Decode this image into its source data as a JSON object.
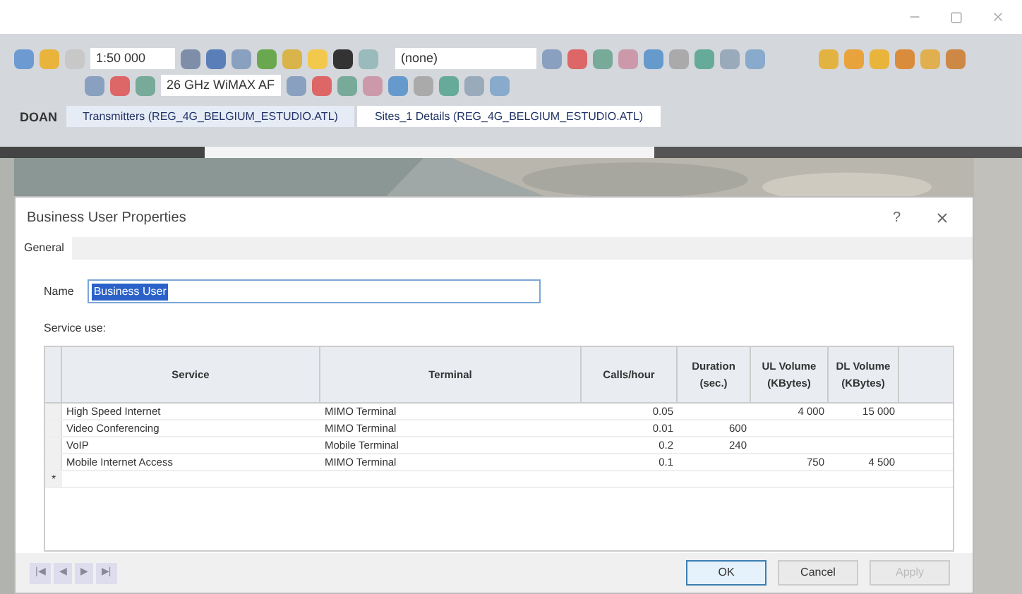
{
  "toolbar": {
    "scale": "1:50 000",
    "frequency_band": "26 GHz WiMAX AF",
    "filter": "(none)"
  },
  "document_tabs": [
    {
      "label": "DOAN",
      "kind": "app",
      "selected": false
    },
    {
      "label": "Transmitters (REG_4G_BELGIUM_ESTUDIO.ATL)",
      "kind": "tab",
      "selected": false
    },
    {
      "label": "Sites_1 Details (REG_4G_BELGIUM_ESTUDIO.ATL)",
      "kind": "tab",
      "selected": true
    }
  ],
  "dialog": {
    "title": "Business User Properties",
    "help": "?",
    "tabs": [
      {
        "label": "General",
        "selected": true
      }
    ],
    "name_label": "Name",
    "name_value": "Business User",
    "name_selected": true,
    "service_use_label": "Service use:",
    "table": {
      "columns": [
        "Service",
        "Terminal",
        "Calls/hour",
        "Duration (sec.)",
        "UL Volume (KBytes)",
        "DL Volume (KBytes)"
      ],
      "rows": [
        [
          "High Speed Internet",
          "MIMO Terminal",
          "0.05",
          "",
          "4 000",
          "15 000"
        ],
        [
          "Video Conferencing",
          "MIMO Terminal",
          "0.01",
          "600",
          "",
          ""
        ],
        [
          "VoIP",
          "Mobile Terminal",
          "0.2",
          "240",
          "",
          ""
        ],
        [
          "Mobile Internet Access",
          "MIMO Terminal",
          "0.1",
          "",
          "750",
          "4 500"
        ]
      ],
      "new_row_marker": "*"
    },
    "navigation": [
      "|◀",
      "◀",
      "▶",
      "▶|"
    ],
    "buttons": [
      {
        "label": "OK",
        "disabled": false,
        "default": true
      },
      {
        "label": "Cancel",
        "disabled": false,
        "default": false
      },
      {
        "label": "Apply",
        "disabled": true,
        "default": false
      }
    ]
  }
}
